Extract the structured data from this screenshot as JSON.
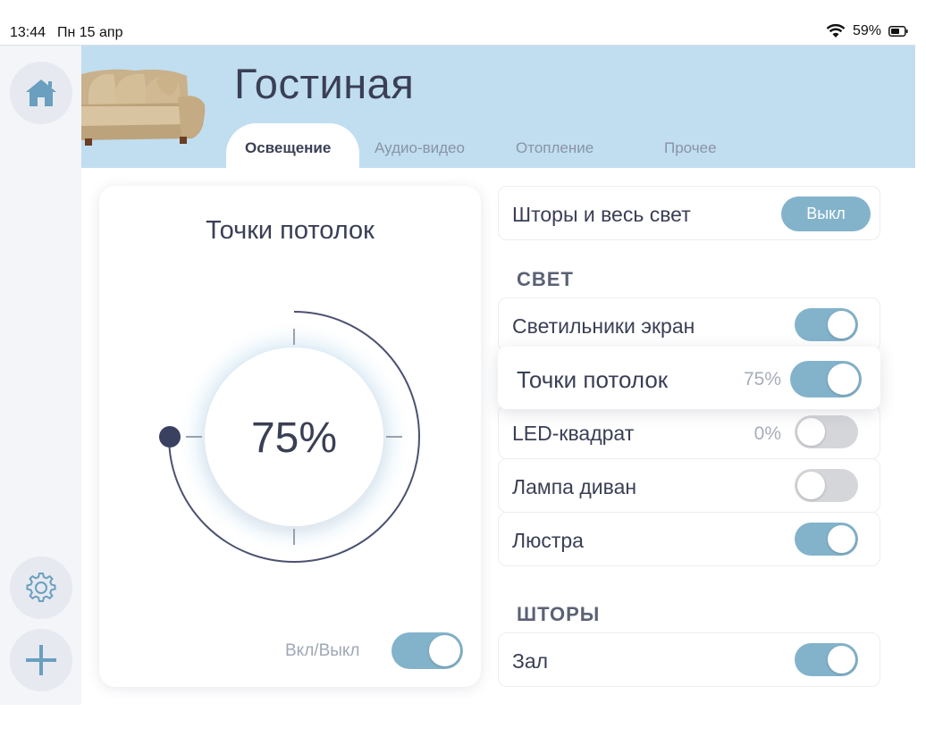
{
  "status": {
    "time": "13:44",
    "date": "Пн 15 апр",
    "battery": "59%"
  },
  "header": {
    "room_title": "Гостиная"
  },
  "tabs": [
    {
      "label": "Освещение",
      "active": true
    },
    {
      "label": "Аудио-видео",
      "active": false
    },
    {
      "label": "Отопление",
      "active": false
    },
    {
      "label": "Прочее",
      "active": false
    }
  ],
  "sidebar": {
    "items": [
      "home-icon",
      "gear-icon",
      "plus-icon"
    ]
  },
  "dimmer": {
    "title": "Точки потолок",
    "value": "75%",
    "level": 0.75,
    "onoff_label": "Вкл/Выкл",
    "on": true
  },
  "all_lights": {
    "label": "Шторы и весь свет",
    "button": "Выкл"
  },
  "lights": {
    "section_title": "СВЕТ",
    "items": [
      {
        "label": "Светильники экран",
        "pct": "",
        "on": true
      },
      {
        "label": "Точки потолок",
        "pct": "75%",
        "on": true
      },
      {
        "label": "LED-квадрат",
        "pct": "0%",
        "on": false
      },
      {
        "label": "Лампа диван",
        "pct": "",
        "on": false
      },
      {
        "label": "Люстра",
        "pct": "",
        "on": true
      }
    ]
  },
  "curtains": {
    "section_title": "ШТОРЫ",
    "items": [
      {
        "label": "Зал",
        "on": true
      }
    ]
  },
  "colors": {
    "accent": "#83b3cb",
    "header_bg": "#c0def0",
    "text": "#3a3f55",
    "toggle_off": "#d5d6da"
  }
}
